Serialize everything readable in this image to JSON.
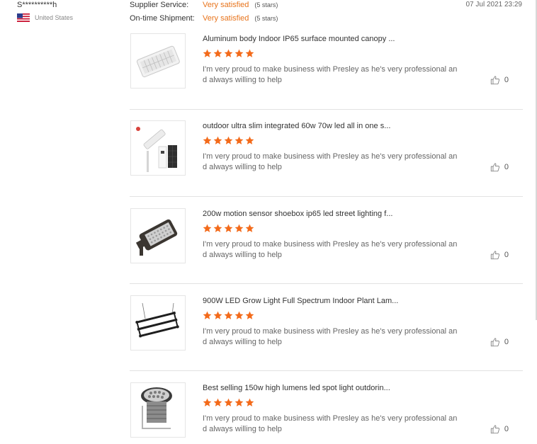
{
  "reviewer": {
    "name": "S**********h",
    "country": "United States",
    "flag_icon": "us-flag-icon"
  },
  "ratings": [
    {
      "label": "Supplier Service:",
      "value": "Very satisfied",
      "stars": "(5 stars)"
    },
    {
      "label": "On-time Shipment:",
      "value": "Very satisfied",
      "stars": "(5 stars)"
    }
  ],
  "review_date": "07 Jul 2021 23:29",
  "colors": {
    "accent": "#e8741c",
    "star": "#f36a1a",
    "divider": "#e2e2e2"
  },
  "products": [
    {
      "title": "Aluminum body Indoor IP65 surface mounted canopy ...",
      "rating": 5,
      "comment": "I'm very proud to make business with Presley as he's very professional and always willing to help",
      "likes": "0",
      "image_icon": "canopy-light-icon"
    },
    {
      "title": "outdoor ultra slim integrated 60w 70w led all in one s...",
      "rating": 5,
      "comment": "I'm very proud to make business with Presley as he's very professional and always willing to help",
      "likes": "0",
      "image_icon": "solar-street-light-icon"
    },
    {
      "title": "200w motion sensor shoebox ip65 led street lighting f...",
      "rating": 5,
      "comment": "I'm very proud to make business with Presley as he's very professional and always willing to help",
      "likes": "0",
      "image_icon": "shoebox-light-icon"
    },
    {
      "title": "900W LED Grow Light Full Spectrum Indoor Plant Lam...",
      "rating": 5,
      "comment": "I'm very proud to make business with Presley as he's very professional and always willing to help",
      "likes": "0",
      "image_icon": "grow-light-icon"
    },
    {
      "title": "Best selling 150w high lumens led spot light outdorin...",
      "rating": 5,
      "comment": "I'm very proud to make business with Presley as he's very professional and always willing to help",
      "likes": "0",
      "image_icon": "spot-light-icon"
    }
  ]
}
